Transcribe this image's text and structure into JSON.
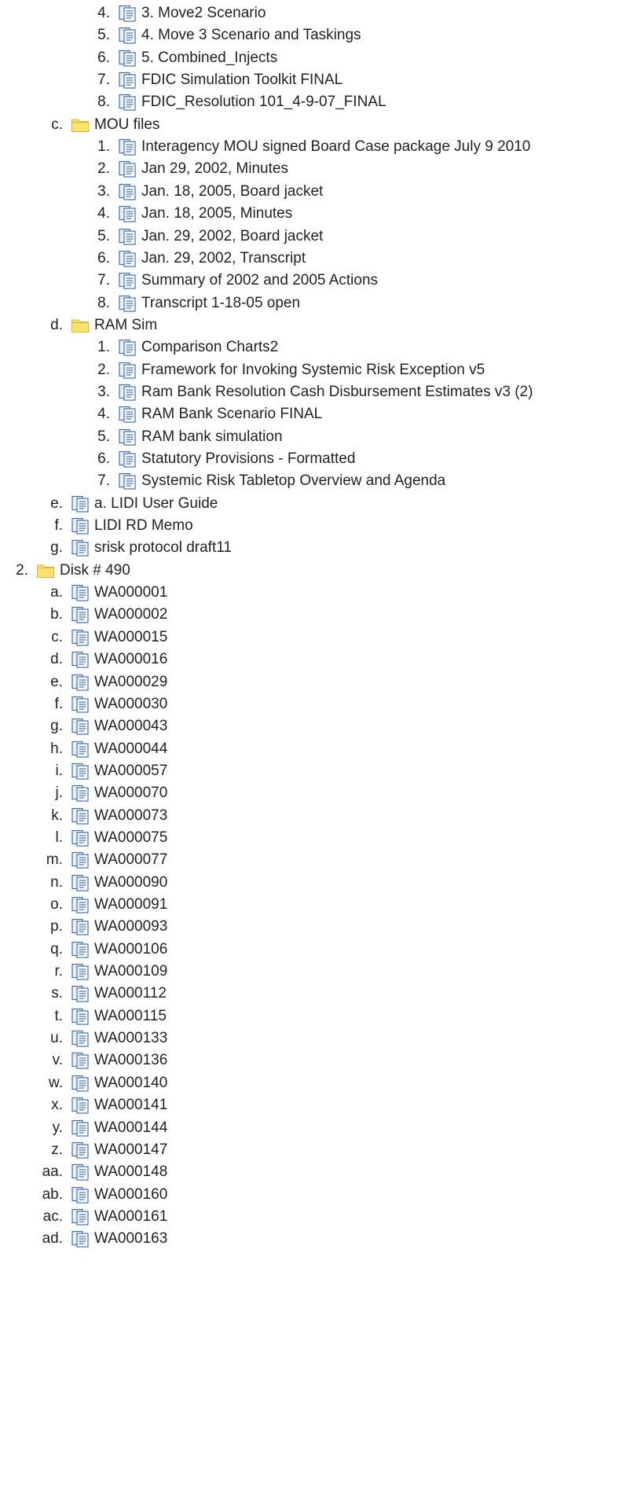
{
  "tree": [
    {
      "level": 2,
      "marker": "4.",
      "icon": "document-icon",
      "label": "3. Move2 Scenario"
    },
    {
      "level": 2,
      "marker": "5.",
      "icon": "document-icon",
      "label": "4. Move 3 Scenario and Taskings"
    },
    {
      "level": 2,
      "marker": "6.",
      "icon": "document-icon",
      "label": "5. Combined_Injects"
    },
    {
      "level": 2,
      "marker": "7.",
      "icon": "document-icon",
      "label": "FDIC Simulation Toolkit FINAL"
    },
    {
      "level": 2,
      "marker": "8.",
      "icon": "document-icon",
      "label": "FDIC_Resolution 101_4-9-07_FINAL"
    },
    {
      "level": 1,
      "marker": "c.",
      "icon": "folder-icon",
      "label": "MOU files"
    },
    {
      "level": 2,
      "marker": "1.",
      "icon": "document-icon",
      "label": "Interagency MOU signed Board Case package July 9 2010"
    },
    {
      "level": 2,
      "marker": "2.",
      "icon": "document-icon",
      "label": "Jan 29, 2002, Minutes"
    },
    {
      "level": 2,
      "marker": "3.",
      "icon": "document-icon",
      "label": "Jan. 18, 2005, Board jacket"
    },
    {
      "level": 2,
      "marker": "4.",
      "icon": "document-icon",
      "label": "Jan. 18, 2005, Minutes"
    },
    {
      "level": 2,
      "marker": "5.",
      "icon": "document-icon",
      "label": "Jan. 29, 2002, Board jacket"
    },
    {
      "level": 2,
      "marker": "6.",
      "icon": "document-icon",
      "label": "Jan. 29, 2002, Transcript"
    },
    {
      "level": 2,
      "marker": "7.",
      "icon": "document-icon",
      "label": "Summary of 2002 and 2005 Actions"
    },
    {
      "level": 2,
      "marker": "8.",
      "icon": "document-icon",
      "label": "Transcript 1-18-05 open"
    },
    {
      "level": 1,
      "marker": "d.",
      "icon": "folder-icon",
      "label": "RAM Sim"
    },
    {
      "level": 2,
      "marker": "1.",
      "icon": "document-icon",
      "label": "Comparison Charts2"
    },
    {
      "level": 2,
      "marker": "2.",
      "icon": "document-icon",
      "label": "Framework for Invoking Systemic Risk Exception v5"
    },
    {
      "level": 2,
      "marker": "3.",
      "icon": "document-icon",
      "label": "Ram Bank Resolution Cash Disbursement Estimates v3 (2)"
    },
    {
      "level": 2,
      "marker": "4.",
      "icon": "document-icon",
      "label": "RAM Bank Scenario FINAL"
    },
    {
      "level": 2,
      "marker": "5.",
      "icon": "document-icon",
      "label": "RAM bank simulation"
    },
    {
      "level": 2,
      "marker": "6.",
      "icon": "document-icon",
      "label": "Statutory Provisions - Formatted"
    },
    {
      "level": 2,
      "marker": "7.",
      "icon": "document-icon",
      "label": "Systemic Risk Tabletop Overview and Agenda"
    },
    {
      "level": 1,
      "marker": "e.",
      "icon": "document-icon",
      "label": "a. LIDI User Guide"
    },
    {
      "level": 1,
      "marker": "f.",
      "icon": "document-icon",
      "label": "LIDI RD Memo"
    },
    {
      "level": 1,
      "marker": "g.",
      "icon": "document-icon",
      "label": "srisk protocol draft11"
    },
    {
      "level": 0,
      "marker": "2.",
      "icon": "folder-icon",
      "label": "Disk # 490"
    },
    {
      "level": 1,
      "marker": "a.",
      "icon": "document-icon",
      "label": "WA000001"
    },
    {
      "level": 1,
      "marker": "b.",
      "icon": "document-icon",
      "label": "WA000002"
    },
    {
      "level": 1,
      "marker": "c.",
      "icon": "document-icon",
      "label": "WA000015"
    },
    {
      "level": 1,
      "marker": "d.",
      "icon": "document-icon",
      "label": "WA000016"
    },
    {
      "level": 1,
      "marker": "e.",
      "icon": "document-icon",
      "label": "WA000029"
    },
    {
      "level": 1,
      "marker": "f.",
      "icon": "document-icon",
      "label": "WA000030"
    },
    {
      "level": 1,
      "marker": "g.",
      "icon": "document-icon",
      "label": "WA000043"
    },
    {
      "level": 1,
      "marker": "h.",
      "icon": "document-icon",
      "label": "WA000044"
    },
    {
      "level": 1,
      "marker": "i.",
      "icon": "document-icon",
      "label": "WA000057"
    },
    {
      "level": 1,
      "marker": "j.",
      "icon": "document-icon",
      "label": "WA000070"
    },
    {
      "level": 1,
      "marker": "k.",
      "icon": "document-icon",
      "label": "WA000073"
    },
    {
      "level": 1,
      "marker": "l.",
      "icon": "document-icon",
      "label": "WA000075"
    },
    {
      "level": 1,
      "marker": "m.",
      "icon": "document-icon",
      "label": "WA000077"
    },
    {
      "level": 1,
      "marker": "n.",
      "icon": "document-icon",
      "label": "WA000090"
    },
    {
      "level": 1,
      "marker": "o.",
      "icon": "document-icon",
      "label": "WA000091"
    },
    {
      "level": 1,
      "marker": "p.",
      "icon": "document-icon",
      "label": "WA000093"
    },
    {
      "level": 1,
      "marker": "q.",
      "icon": "document-icon",
      "label": "WA000106"
    },
    {
      "level": 1,
      "marker": "r.",
      "icon": "document-icon",
      "label": "WA000109"
    },
    {
      "level": 1,
      "marker": "s.",
      "icon": "document-icon",
      "label": "WA000112"
    },
    {
      "level": 1,
      "marker": "t.",
      "icon": "document-icon",
      "label": "WA000115"
    },
    {
      "level": 1,
      "marker": "u.",
      "icon": "document-icon",
      "label": "WA000133"
    },
    {
      "level": 1,
      "marker": "v.",
      "icon": "document-icon",
      "label": "WA000136"
    },
    {
      "level": 1,
      "marker": "w.",
      "icon": "document-icon",
      "label": "WA000140"
    },
    {
      "level": 1,
      "marker": "x.",
      "icon": "document-icon",
      "label": "WA000141"
    },
    {
      "level": 1,
      "marker": "y.",
      "icon": "document-icon",
      "label": "WA000144"
    },
    {
      "level": 1,
      "marker": "z.",
      "icon": "document-icon",
      "label": "WA000147"
    },
    {
      "level": 1,
      "marker": "aa.",
      "icon": "document-icon",
      "label": "WA000148"
    },
    {
      "level": 1,
      "marker": "ab.",
      "icon": "document-icon",
      "label": "WA000160"
    },
    {
      "level": 1,
      "marker": "ac.",
      "icon": "document-icon",
      "label": "WA000161"
    },
    {
      "level": 1,
      "marker": "ad.",
      "icon": "document-icon",
      "label": "WA000163"
    }
  ],
  "colors": {
    "text": "#222222",
    "folder_fill": "#fde36b",
    "folder_stroke": "#d8b23a",
    "doc_stroke": "#3f6fb6",
    "doc_fill": "#eaf1fb"
  }
}
